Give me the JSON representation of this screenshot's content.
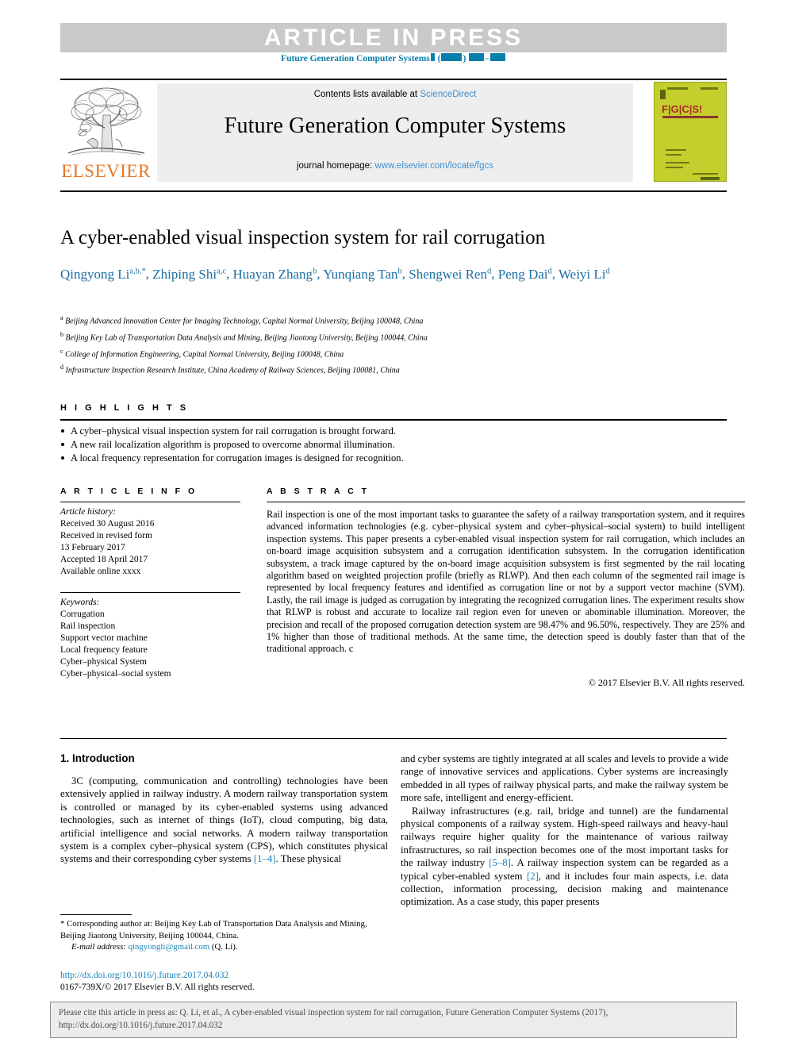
{
  "banner": {
    "article_in_press": "ARTICLE IN PRESS",
    "journal_ref_prefix": "Future Generation Computer Systems"
  },
  "masthead": {
    "publisher": "ELSEVIER",
    "contents_prefix": "Contents lists available at ",
    "contents_link": "ScienceDirect",
    "journal_title": "Future Generation Computer Systems",
    "homepage_prefix": "journal homepage: ",
    "homepage_link": "www.elsevier.com/locate/fgcs",
    "cover_logo": "F|G|C|S!"
  },
  "article": {
    "title": "A cyber-enabled visual inspection system for rail corrugation",
    "authors": [
      {
        "name": "Qingyong Li",
        "sup": "a,b,*"
      },
      {
        "name": "Zhiping Shi",
        "sup": "a,c"
      },
      {
        "name": "Huayan Zhang",
        "sup": "b"
      },
      {
        "name": "Yunqiang Tan",
        "sup": "b"
      },
      {
        "name": "Shengwei Ren",
        "sup": "d"
      },
      {
        "name": "Peng Dai",
        "sup": "d"
      },
      {
        "name": "Weiyi Li",
        "sup": "d"
      }
    ],
    "affiliations": [
      {
        "marker": "a",
        "text": "Beijing Advanced Innovation Center for Imaging Technology, Capital Normal University, Beijing 100048, China"
      },
      {
        "marker": "b",
        "text": "Beijing Key Lab of Transportation Data Analysis and Mining, Beijing Jiaotong University, Beijing 100044, China"
      },
      {
        "marker": "c",
        "text": "College of Information Engineering, Capital Normal University, Beijing 100048, China"
      },
      {
        "marker": "d",
        "text": "Infrastructure Inspection Research Institute, China Academy of Railway Sciences, Beijing 100081, China"
      }
    ]
  },
  "highlights": {
    "heading": "H I G H L I G H T S",
    "items": [
      "A cyber–physical visual inspection system for rail corrugation is brought forward.",
      "A new rail localization algorithm is proposed to overcome abnormal illumination.",
      "A local frequency representation for corrugation images is designed for recognition."
    ]
  },
  "article_info": {
    "heading": "A R T I C L E    I N F O",
    "history_label": "Article history:",
    "history": [
      "Received 30 August 2016",
      "Received in revised form",
      "13 February 2017",
      "Accepted 18 April 2017",
      "Available online xxxx"
    ],
    "keywords_label": "Keywords:",
    "keywords": [
      "Corrugation",
      "Rail inspection",
      "Support vector machine",
      "Local frequency feature",
      "Cyber–physical System",
      "Cyber–physical–social system"
    ]
  },
  "abstract": {
    "heading": "A B S T R A C T",
    "body": "Rail inspection is one of the most important tasks to guarantee the safety of a railway transportation system, and it requires advanced information technologies (e.g. cyber–physical system and cyber–physical–social system) to build intelligent inspection systems. This paper presents a cyber-enabled visual inspection system for rail corrugation, which includes an on-board image acquisition subsystem and a corrugation identification subsystem. In the corrugation identification subsystem, a track image captured by the on-board image acquisition subsystem is first segmented by the rail locating algorithm based on weighted projection profile (briefly as RLWP). And then each column of the segmented rail image is represented by local frequency features and identified as corrugation line or not by a support vector machine (SVM). Lastly, the rail image is judged as corrugation by integrating the recognized corrugation lines. The experiment results show that RLWP is robust and accurate to localize rail region even for uneven or abominable illumination. Moreover, the precision and recall of the proposed corrugation detection system are 98.47% and 96.50%, respectively. They are 25% and 1% higher than those of traditional methods. At the same time, the detection speed is doubly faster than that of the traditional approach. c",
    "copyright": "© 2017 Elsevier B.V. All rights reserved."
  },
  "introduction": {
    "section_number_title": "1. Introduction",
    "left_paragraph": "3C (computing, communication and controlling) technologies have been extensively applied in railway industry. A modern railway transportation system is controlled or managed by its cyber-enabled systems using advanced technologies, such as internet of things (IoT), cloud computing, big data, artificial intelligence and social networks. A modern railway transportation system is a complex cyber–physical system (CPS), which constitutes physical systems and their corresponding cyber systems ",
    "left_ref": "[1–4]",
    "left_paragraph_tail": ". These physical",
    "right_paragraph_1": "and cyber systems are tightly integrated at all scales and levels to provide a wide range of innovative services and applications. Cyber systems are increasingly embedded in all types of railway physical parts, and make the railway system be more safe, intelligent and energy-efficient.",
    "right_paragraph_2_a": "Railway infrastructures (e.g. rail, bridge and tunnel) are the fundamental physical components of a railway system. High-speed railways and heavy-haul railways require higher quality for the maintenance of various railway infrastructures, so rail inspection becomes one of the most important tasks for the railway industry ",
    "right_ref_1": "[5–8]",
    "right_paragraph_2_b": ". A railway inspection system can be regarded as a typical cyber-enabled system ",
    "right_ref_2": "[2]",
    "right_paragraph_2_c": ", and it includes four main aspects, i.e. data collection, information processing, decision making and maintenance optimization. As a case study, this paper presents"
  },
  "footnote": {
    "star": "*",
    "corresponding": "Corresponding author at: Beijing Key Lab of Transportation Data Analysis and Mining, Beijing Jiaotong University, Beijing 100044, China.",
    "email_label": "E-mail address:",
    "email": "qingyongli@gmail.com",
    "email_owner": "(Q. Li).",
    "doi": "http://dx.doi.org/10.1016/j.future.2017.04.032",
    "issn_copyright": "0167-739X/© 2017 Elsevier B.V. All rights reserved."
  },
  "citation_box": {
    "line1": "Please cite this article in press as: Q. Li, et al., A cyber-enabled visual inspection system for rail corrugation, Future Generation Computer Systems (2017),",
    "line2": "http://dx.doi.org/10.1016/j.future.2017.04.032"
  },
  "colors": {
    "link_blue": "#3f8fd0",
    "journal_teal": "#0b7fab",
    "author_blue": "#1a6fa3",
    "ref_blue": "#1a82b8",
    "elsevier_orange": "#e87722",
    "banner_grey": "#c9c9c9",
    "panel_grey": "#eeeeee",
    "cover_green": "#c4ce2c"
  }
}
